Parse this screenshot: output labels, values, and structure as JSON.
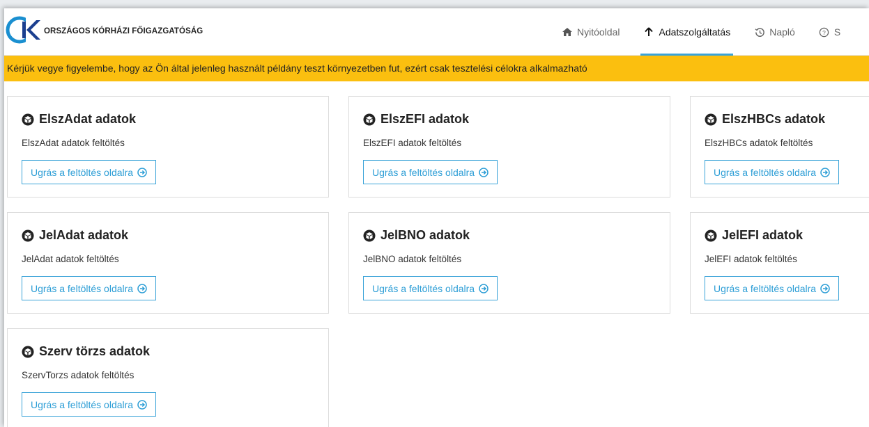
{
  "org": {
    "name": "ORSZÁGOS KÓRHÁZI FŐIGAZGATÓSÁG",
    "logo_icon": "okfo-logo-icon"
  },
  "nav": {
    "items": [
      {
        "label": "Nyitóoldal",
        "icon": "home-icon"
      },
      {
        "label": "Adatszolgáltatás",
        "icon": "arrow-up-icon",
        "active": true
      },
      {
        "label": "Napló",
        "icon": "history-icon"
      },
      {
        "label": "S",
        "icon": "help-circle-icon"
      }
    ]
  },
  "banner": {
    "text": "Kérjük vegye figyelembe, hogy az Ön által jelenleg használt példány teszt környezetben fut, ezért csak tesztelési célokra alkalmazható"
  },
  "cards": [
    {
      "title": "ElszAdat adatok",
      "description": "ElszAdat adatok feltöltés",
      "button": "Ugrás a feltöltés oldalra"
    },
    {
      "title": "ElszEFI adatok",
      "description": "ElszEFI adatok feltöltés",
      "button": "Ugrás a feltöltés oldalra"
    },
    {
      "title": "ElszHBCs adatok",
      "description": "ElszHBCs adatok feltöltés",
      "button": "Ugrás a feltöltés oldalra"
    },
    {
      "title": "JelAdat adatok",
      "description": "JelAdat adatok feltöltés",
      "button": "Ugrás a feltöltés oldalra"
    },
    {
      "title": "JelBNO adatok",
      "description": "JelBNO adatok feltöltés",
      "button": "Ugrás a feltöltés oldalra"
    },
    {
      "title": "JelEFI adatok",
      "description": "JelEFI adatok feltöltés",
      "button": "Ugrás a feltöltés oldalra"
    },
    {
      "title": "Szerv törzs adatok",
      "description": "SzervTorzs adatok feltöltés",
      "button": "Ugrás a feltöltés oldalra"
    }
  ],
  "colors": {
    "accent": "#3aa3d8",
    "banner": "#fbbf0f",
    "text": "#222222"
  }
}
